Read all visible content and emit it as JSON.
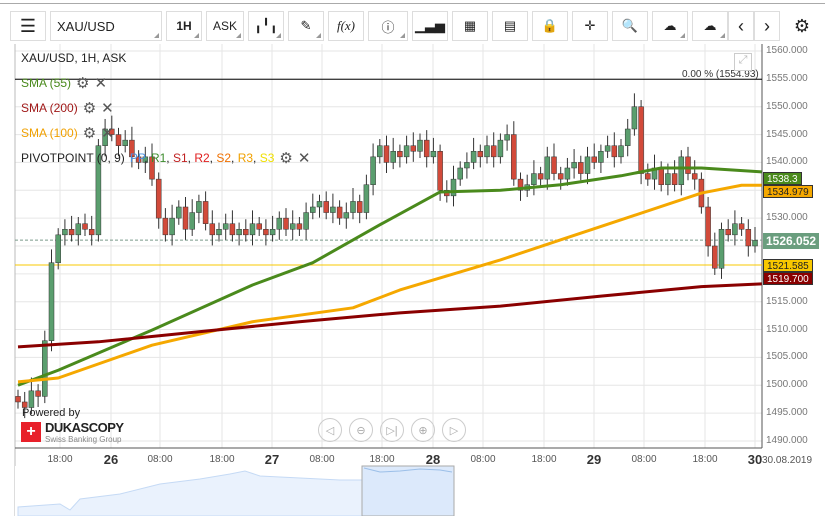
{
  "toolbar": {
    "menu_icon": "hamburger-icon",
    "instrument": "XAU/USD",
    "period": "1H",
    "side": "ASK",
    "settings_icon": "gear-icon"
  },
  "chart": {
    "title": "XAU/USD, 1H, ASK",
    "indicators": [
      {
        "label": "SMA (55)",
        "color": "#4a8a1c"
      },
      {
        "label": "SMA (200)",
        "color": "#a01818"
      },
      {
        "label": "SMA (100)",
        "color": "#f0a000"
      }
    ],
    "pivot": {
      "label": "PIVOTPOINT (0, 9)",
      "parts": [
        {
          "t": "PP",
          "c": "#4a90e2"
        },
        {
          "t": "R1",
          "c": "#3a8a2a"
        },
        {
          "t": "S1",
          "c": "#c02020"
        },
        {
          "t": "R2",
          "c": "#e02020"
        },
        {
          "t": "S2",
          "c": "#f07000"
        },
        {
          "t": "R3",
          "c": "#f0a000"
        },
        {
          "t": "S3",
          "c": "#f0e000"
        }
      ]
    },
    "fib_label": "0.00 % (1554.93)",
    "price_labels": [
      "1560.000",
      "1555.000",
      "1550.000",
      "1545.000",
      "1540.000",
      "1535.000",
      "1530.000",
      "1525.000",
      "1520.000",
      "1515.000",
      "1510.000",
      "1505.000",
      "1500.000",
      "1495.000",
      "1490.000"
    ],
    "tags": {
      "sma55": "1538.3",
      "sma100": "1534.979",
      "current": "1526.052",
      "pivot": "1521.585",
      "sma200": "1519.700"
    },
    "x_labels": [
      "18:00",
      "26",
      "08:00",
      "18:00",
      "27",
      "08:00",
      "18:00",
      "28",
      "08:00",
      "18:00",
      "29",
      "08:00",
      "18:00",
      "30"
    ],
    "date_label": "30.08.2019",
    "powered_by": "Powered by",
    "brand": "DUKASCOPY",
    "brand_sub": "Swiss Banking Group",
    "closes": [
      1497,
      1496,
      1499,
      1498,
      1508,
      1522,
      1527,
      1528,
      1527,
      1529,
      1528,
      1527,
      1543,
      1546,
      1545,
      1543,
      1544,
      1541,
      1540,
      1541,
      1537,
      1530,
      1527,
      1530,
      1532,
      1528,
      1531,
      1533,
      1529,
      1527,
      1528,
      1529,
      1527,
      1528,
      1527,
      1529,
      1528,
      1527,
      1528,
      1530,
      1528,
      1529,
      1528,
      1531,
      1532,
      1533,
      1531,
      1532,
      1530,
      1531,
      1533,
      1531,
      1536,
      1541,
      1543,
      1540,
      1542,
      1541,
      1543,
      1542,
      1544,
      1541,
      1542,
      1535,
      1534,
      1537,
      1539,
      1540,
      1542,
      1541,
      1543,
      1541,
      1544,
      1545,
      1537,
      1535,
      1536,
      1538,
      1537,
      1541,
      1538,
      1537,
      1539,
      1540,
      1538,
      1541,
      1540,
      1542,
      1543,
      1541,
      1543,
      1546,
      1550,
      1538,
      1537,
      1539,
      1536,
      1538,
      1536,
      1541,
      1538,
      1537,
      1532,
      1525,
      1521,
      1528,
      1527,
      1529,
      1528,
      1525,
      1526
    ],
    "sma55": [
      [
        0,
        1500.0
      ],
      [
        6,
        1502.7
      ],
      [
        20,
        1509.9
      ],
      [
        35,
        1518.0
      ],
      [
        44,
        1522.0
      ],
      [
        54,
        1528.8
      ],
      [
        63,
        1534.7
      ],
      [
        72,
        1535.0
      ],
      [
        81,
        1536.0
      ],
      [
        90,
        1537.6
      ],
      [
        96,
        1539.0
      ],
      [
        102,
        1539.0
      ],
      [
        111,
        1538.3
      ]
    ],
    "sma100": [
      [
        0,
        1500.6
      ],
      [
        6,
        1501.3
      ],
      [
        20,
        1507.2
      ],
      [
        35,
        1511.4
      ],
      [
        50,
        1513.9
      ],
      [
        57,
        1517.1
      ],
      [
        72,
        1522.5
      ],
      [
        81,
        1526.1
      ],
      [
        90,
        1529.7
      ],
      [
        102,
        1534.5
      ],
      [
        108,
        1535.9
      ],
      [
        111,
        1535.9
      ]
    ],
    "sma200": [
      [
        0,
        1506.9
      ],
      [
        12,
        1507.8
      ],
      [
        27,
        1509.6
      ],
      [
        42,
        1511.4
      ],
      [
        57,
        1513.0
      ],
      [
        72,
        1514.2
      ],
      [
        87,
        1516.0
      ],
      [
        102,
        1517.7
      ],
      [
        111,
        1518.2
      ]
    ]
  }
}
